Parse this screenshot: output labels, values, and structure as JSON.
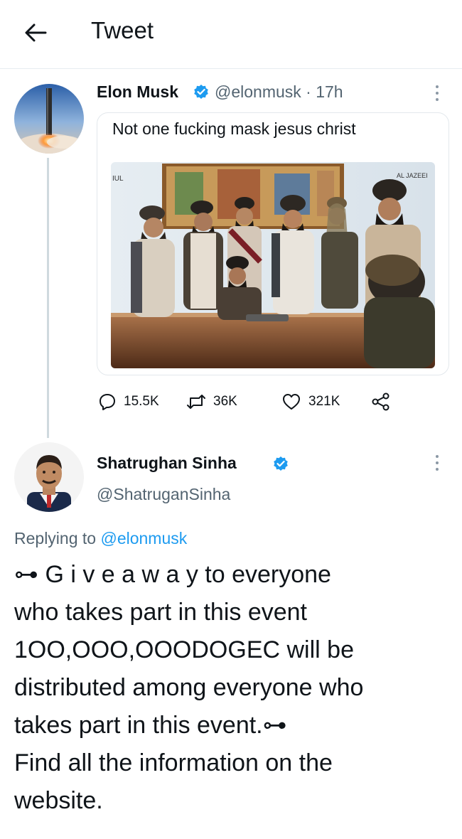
{
  "header": {
    "title": "Tweet"
  },
  "tweet": {
    "author_name": "Elon Musk",
    "handle_time": "@elonmusk · 17h",
    "text": "Not one fucking mask jesus christ",
    "image": {
      "watermark_left": "IUL",
      "watermark_right": "AL JAZEEI"
    },
    "replies": "15.5K",
    "retweets": "36K",
    "likes": "321K"
  },
  "reply": {
    "author_name": "Shatrughan Sinha",
    "handle": "@ShatruganSinha",
    "replying_prefix": "Replying to",
    "replying_to": "@elonmusk",
    "lines": [
      "⊶ G i v e a w a y to everyone",
      "who takes part in this event",
      "1OO,OOO,OOODOGEC will be",
      "distributed among everyone who",
      "takes part in this event.⊶",
      "Find all the information on the",
      "website."
    ]
  },
  "colors": {
    "accent": "#1d9bf0",
    "secondary_text": "#536471",
    "divider": "#e6ecf0"
  }
}
